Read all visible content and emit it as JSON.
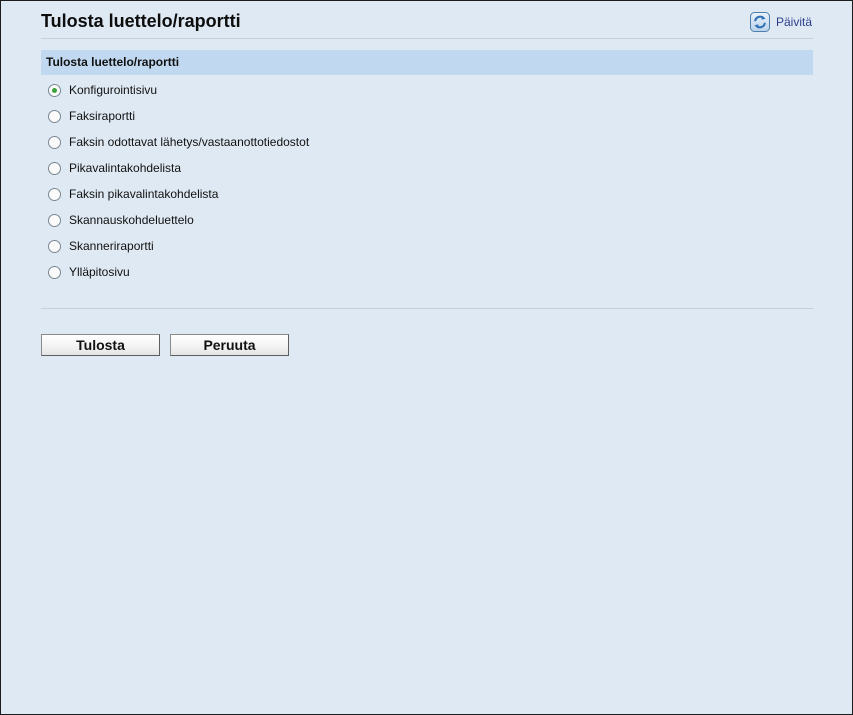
{
  "header": {
    "title": "Tulosta luettelo/raportti",
    "refresh_label": "Päivitä",
    "refresh_icon": "refresh-icon"
  },
  "section": {
    "title": "Tulosta luettelo/raportti"
  },
  "options": [
    {
      "label": "Konfigurointisivu",
      "selected": true
    },
    {
      "label": "Faksiraportti",
      "selected": false
    },
    {
      "label": "Faksin odottavat lähetys/vastaanottotiedostot",
      "selected": false
    },
    {
      "label": "Pikavalintakohdelista",
      "selected": false
    },
    {
      "label": "Faksin pikavalintakohdelista",
      "selected": false
    },
    {
      "label": "Skannauskohdeluettelo",
      "selected": false
    },
    {
      "label": "Skanneriraportti",
      "selected": false
    },
    {
      "label": "Ylläpitosivu",
      "selected": false
    }
  ],
  "buttons": {
    "print_label": "Tulosta",
    "cancel_label": "Peruuta"
  },
  "colors": {
    "background": "#dfe9f3",
    "section_header": "#c1d9f0",
    "link": "#2c3e8c",
    "radio_selected": "#3aa23a"
  }
}
